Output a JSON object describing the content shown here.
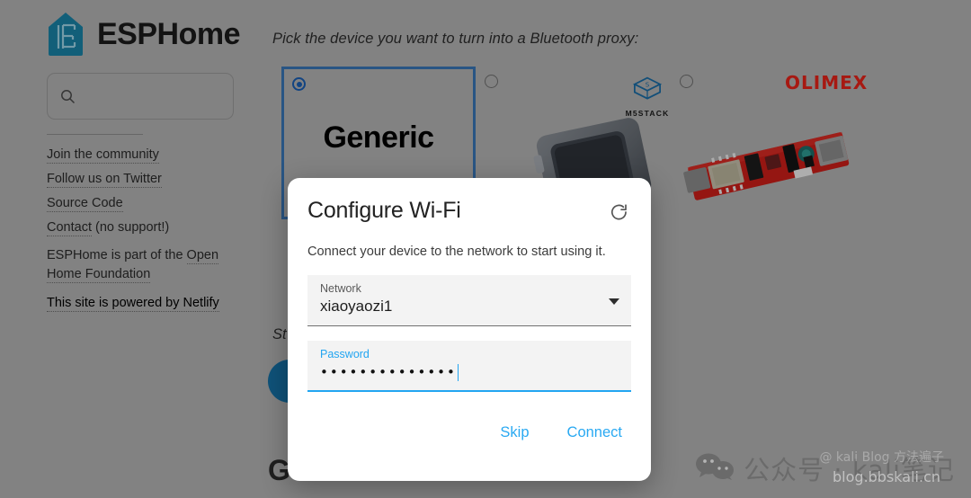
{
  "brand": {
    "name": "ESPHome",
    "logo_icon": "esphome-house-logo"
  },
  "sidebar": {
    "search": {
      "value": "",
      "placeholder": "",
      "icon": "search-icon"
    },
    "links": [
      {
        "label": "Join the community",
        "underline": true
      },
      {
        "label": "Follow us on Twitter",
        "underline": true
      },
      {
        "label": "Source Code",
        "underline": true
      },
      {
        "label": "Contact",
        "suffix": " (no support!)",
        "underline": true
      }
    ],
    "foundation": {
      "prefix": "ESPHome is part of the ",
      "link": "Open Home Foundation"
    },
    "netlify": {
      "label": "This site is powered by Netlify"
    }
  },
  "main": {
    "prompt": "Pick the device you want to turn into a Bluetooth proxy:",
    "cards": [
      {
        "label": "Generic",
        "selected": true,
        "radio_icon": "radio-selected-icon"
      },
      {
        "label": "",
        "selected": false,
        "radio_icon": "radio-unselected-icon",
        "brand_logo": "m5stack-logo",
        "brand_text": "M5STACK"
      },
      {
        "label": "",
        "selected": false,
        "radio_icon": "radio-unselected-icon",
        "brand_logo": "olimex-logo",
        "brand_text": "OLIMEX"
      }
    ],
    "step_label": "St",
    "footer_heading": "G",
    "primary_button_icon": "round-blue-button"
  },
  "dialog": {
    "title": "Configure Wi-Fi",
    "refresh_icon": "refresh-icon",
    "subtitle": "Connect your device to the network to start using it.",
    "network_field": {
      "label": "Network",
      "value": "xiaoyaozi1",
      "dropdown_icon": "chevron-down-icon"
    },
    "password_field": {
      "label": "Password",
      "value": "••••••••••••••",
      "focused": true
    },
    "skip_label": "Skip",
    "connect_label": "Connect"
  },
  "watermark": {
    "wechat_icon": "wechat-icon",
    "text": "公众号 · kali笔记",
    "overlay": "@ kali Blog 方法遍子",
    "url": "blog.bbskali.cn"
  },
  "colors": {
    "page_bg": "#b4b4b4",
    "brand_teal": "#1a84a8",
    "accent_blue": "#29a9f2",
    "selected_border": "#3a77b8",
    "olimex_red": "#e8231a",
    "round_button": "#1572a8"
  }
}
